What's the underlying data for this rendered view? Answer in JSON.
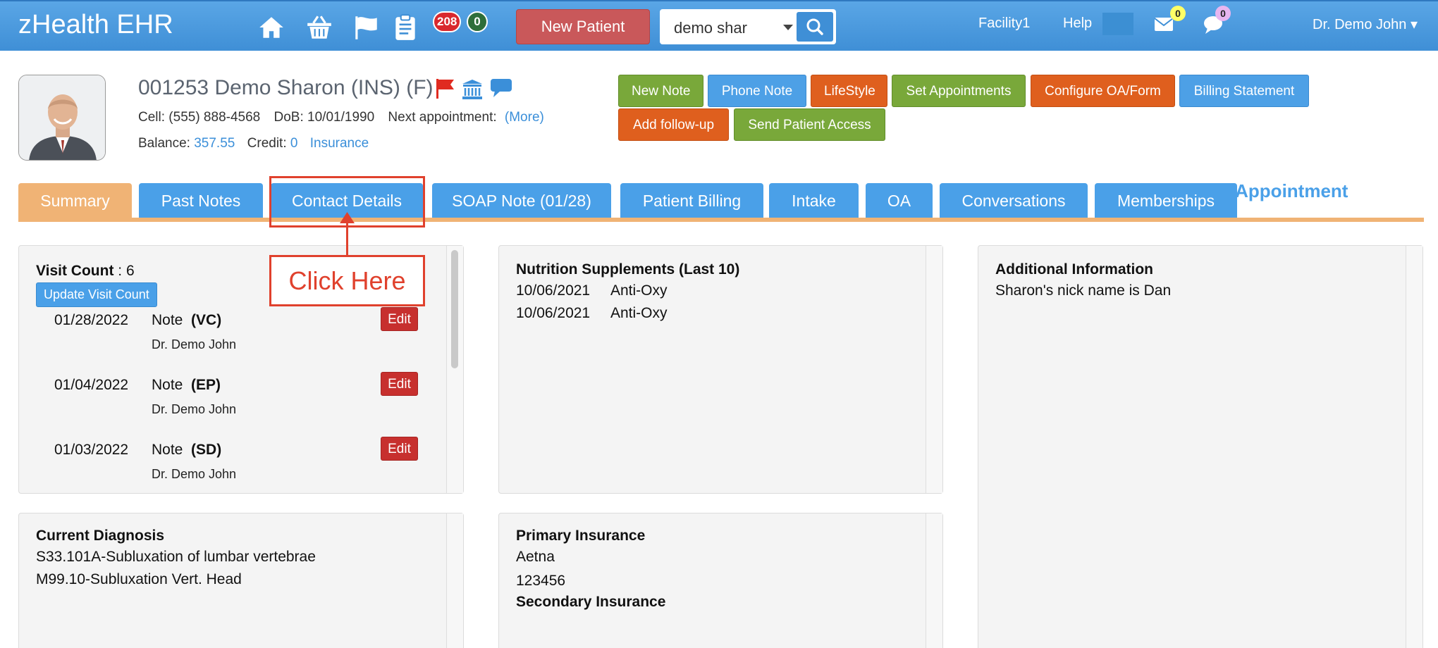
{
  "app": {
    "brand": "zHealth EHR"
  },
  "topbar": {
    "nav_icons": [
      "home-icon",
      "basket-icon",
      "flag-icon",
      "clipboard-icon"
    ],
    "badge_red": "208",
    "badge_green": "0",
    "new_patient_label": "New Patient",
    "search_value": "demo shar",
    "facility": "Facility1",
    "help": "Help",
    "mail_count": "0",
    "chat_count": "0",
    "user": "Dr. Demo John ▾",
    "colors": {
      "bar": "#4a9ae0",
      "new_patient": "#c9585a",
      "badge_red": "#d9282e",
      "badge_green": "#2e6e3a"
    }
  },
  "patient": {
    "name": "001253 Demo Sharon  (INS) (F)",
    "cell_label": "Cell:",
    "cell": "(555) 888-4568",
    "dob_label": "DoB:",
    "dob": "10/01/1990",
    "next_appt_label": "Next appointment:",
    "more_link": "(More)",
    "balance_label": "Balance:",
    "balance": "357.55",
    "credit_label": "Credit:",
    "credit": "0",
    "insurance_link": "Insurance"
  },
  "actions": {
    "new_note": "New Note",
    "phone_note": "Phone Note",
    "lifestyle": "LifeStyle",
    "set_appointments": "Set Appointments",
    "configure_oa": "Configure OA/Form",
    "billing_statement": "Billing Statement",
    "add_followup": "Add follow-up",
    "send_patient_access": "Send Patient Access"
  },
  "tabs": {
    "summary": "Summary",
    "past_notes": "Past Notes",
    "contact_details": "Contact Details",
    "soap_note": "SOAP Note (01/28)",
    "patient_billing": "Patient Billing",
    "intake": "Intake",
    "oa": "OA",
    "conversations": "Conversations",
    "memberships": "Memberships",
    "appointment_partial": "d Appointment"
  },
  "annotation": {
    "callout": "Click Here"
  },
  "visits": {
    "count_label": "Visit Count",
    "count_value": " : 6",
    "update_button": "Update Visit Count",
    "items": [
      {
        "date": "01/28/2022",
        "note": "Note",
        "code": "(VC)",
        "doctor": "Dr. Demo John",
        "edit": "Edit"
      },
      {
        "date": "01/04/2022",
        "note": "Note",
        "code": "(EP)",
        "doctor": "Dr. Demo John",
        "edit": "Edit"
      },
      {
        "date": "01/03/2022",
        "note": "Note",
        "code": "(SD)",
        "doctor": "Dr. Demo John",
        "edit": "Edit"
      }
    ]
  },
  "supplements": {
    "title": "Nutrition Supplements (Last 10)",
    "items": [
      {
        "date": "10/06/2021",
        "name": "Anti-Oxy"
      },
      {
        "date": "10/06/2021",
        "name": "Anti-Oxy"
      }
    ]
  },
  "additional": {
    "title": "Additional Information",
    "text": "Sharon's nick name is Dan"
  },
  "diagnosis": {
    "title": "Current Diagnosis",
    "items": [
      "S33.101A-Subluxation of lumbar vertebrae",
      "M99.10-Subluxation Vert. Head"
    ]
  },
  "insurance": {
    "primary_title": "Primary Insurance",
    "primary_name": "Aetna",
    "primary_id": "123456",
    "secondary_title": "Secondary Insurance"
  }
}
